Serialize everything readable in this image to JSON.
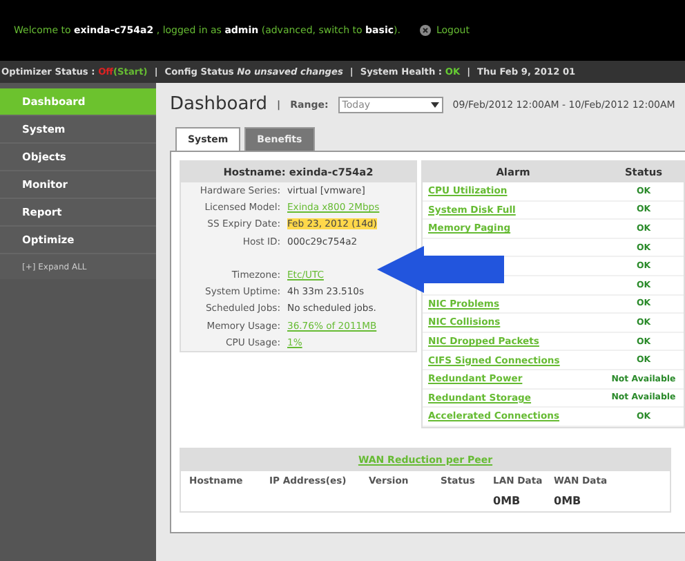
{
  "welcome": {
    "prefix": "Welcome to ",
    "host": "exinda-c754a2",
    "middle": " , logged in as ",
    "user": "admin",
    "mode_prefix": " (advanced, switch to ",
    "mode_link": "basic",
    "mode_suffix": ").",
    "logout": "Logout"
  },
  "separator": "|",
  "status_bar": [
    {
      "kind": "status",
      "label": "Optimizer Status : ",
      "value": "Off",
      "color": "#dd2222",
      "extra": "(Start)"
    },
    {
      "kind": "italic",
      "label": "Config Status ",
      "value": "No unsaved changes"
    },
    {
      "kind": "status",
      "label": "System Health : ",
      "value": "OK",
      "color": "#66cc33"
    },
    {
      "kind": "plain",
      "label": "Thu Feb 9, 2012 01"
    }
  ],
  "sidebar": {
    "items": [
      {
        "label": "Dashboard",
        "selected": true
      },
      {
        "label": "System",
        "selected": false
      },
      {
        "label": "Objects",
        "selected": false
      },
      {
        "label": "Monitor",
        "selected": false
      },
      {
        "label": "Report",
        "selected": false
      },
      {
        "label": "Optimize",
        "selected": false
      }
    ],
    "expand": "[+] Expand ALL"
  },
  "header": {
    "title": "Dashboard",
    "range_label": "Range:",
    "range_value": "Today",
    "range_text": "09/Feb/2012 12:00AM - 10/Feb/2012 12:00AM"
  },
  "tabs": [
    {
      "label": "System",
      "selected": true
    },
    {
      "label": "Benefits",
      "selected": false
    }
  ],
  "info": {
    "title": "Hostname: exinda-c754a2",
    "rows": [
      {
        "label": "Hardware Series:",
        "value": "virtual [vmware]",
        "kind": "text"
      },
      {
        "label": "Licensed Model:",
        "value": "Exinda x800 2Mbps",
        "kind": "link"
      },
      {
        "label": "SS Expiry Date:",
        "value": "Feb 23, 2012 (14d)",
        "kind": "warning"
      },
      {
        "label": "Host ID:",
        "value": "000c29c754a2",
        "kind": "text"
      },
      {
        "kind": "spacer"
      },
      {
        "label": "Timezone:",
        "value": "Etc/UTC",
        "kind": "link"
      },
      {
        "label": "System Uptime:",
        "value": "4h 33m 23.510s",
        "kind": "text"
      },
      {
        "label": "Scheduled Jobs:",
        "value": "No scheduled jobs.",
        "kind": "text"
      },
      {
        "label": "Memory Usage:",
        "value": "36.76% of 2011MB",
        "kind": "link"
      },
      {
        "label": "CPU Usage:",
        "value": "1%",
        "kind": "link"
      }
    ]
  },
  "alarms": {
    "columns": [
      "Alarm",
      "Status"
    ],
    "rows": [
      {
        "name": "CPU Utilization",
        "status": "OK"
      },
      {
        "name": "System Disk Full",
        "status": "OK"
      },
      {
        "name": "Memory Paging",
        "status": "OK"
      },
      {
        "status": "OK"
      },
      {
        "status": "OK"
      },
      {
        "status": "OK"
      },
      {
        "name": "NIC Problems",
        "status": "OK"
      },
      {
        "name": "NIC Collisions",
        "status": "OK"
      },
      {
        "name": "NIC Dropped Packets",
        "status": "OK"
      },
      {
        "name": "CIFS Signed Connections",
        "status": "OK"
      },
      {
        "name": "Redundant Power",
        "status": "Not Available"
      },
      {
        "name": "Redundant Storage",
        "status": "Not Available"
      },
      {
        "name": "Accelerated Connections",
        "status": "OK"
      }
    ]
  },
  "wan": {
    "title": "WAN Reduction per Peer",
    "columns": [
      "Hostname",
      "IP Address(es)",
      "Version",
      "Status",
      "LAN Data",
      "WAN Data"
    ],
    "row": {
      "lan_data": "0MB",
      "wan_data": "0MB"
    }
  }
}
